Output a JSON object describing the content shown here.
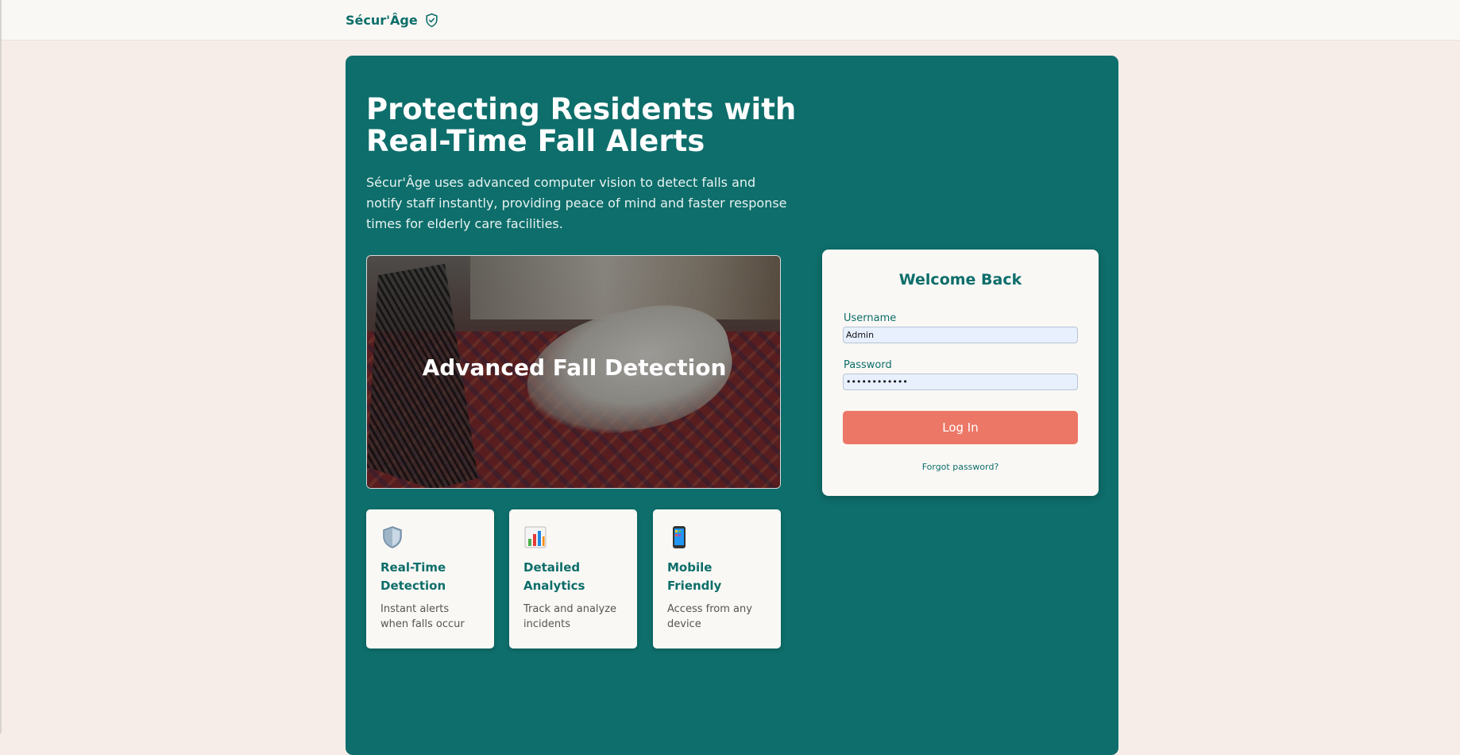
{
  "header": {
    "brand_name": "Sécur'Âge",
    "brand_icon": "shield-check-icon"
  },
  "hero": {
    "headline": "Protecting Residents with Real-Time Fall Alerts",
    "subtext": "Sécur'Âge uses advanced computer vision to detect falls and notify staff instantly, providing peace of mind and faster response times for elderly care facilities.",
    "image_caption": "Advanced Fall Detection"
  },
  "features": [
    {
      "icon": "shield-icon",
      "title": "Real-Time Detection",
      "desc": "Instant alerts when falls occur"
    },
    {
      "icon": "bar-chart-icon",
      "title": "Detailed Analytics",
      "desc": "Track and analyze incidents"
    },
    {
      "icon": "mobile-phone-icon",
      "title": "Mobile Friendly",
      "desc": "Access from any device"
    }
  ],
  "login": {
    "title": "Welcome Back",
    "username_label": "Username",
    "username_value": "Admin",
    "password_label": "Password",
    "password_value": "••••••••••••",
    "submit_label": "Log In",
    "forgot_label": "Forgot password?"
  },
  "colors": {
    "primary": "#0e6e6b",
    "accent": "#ec7766",
    "background": "#f6ede8",
    "card": "#faf8f5"
  }
}
